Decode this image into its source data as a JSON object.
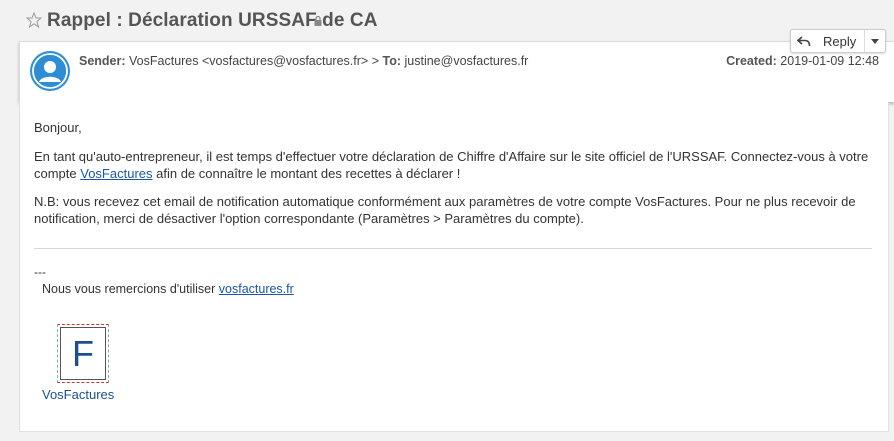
{
  "subject": {
    "title": "Rappel : Déclaration URSSAF de CA",
    "star_icon": "star-outline-icon",
    "lock_icon": "lock-icon"
  },
  "header": {
    "sender_label": "Sender:",
    "sender_value": "VosFactures <vosfactures@vosfactures.fr>",
    "separator": ">",
    "to_label": "To:",
    "to_value": "justine@vosfactures.fr",
    "created_label": "Created:",
    "created_value": "2019-01-09 12:48",
    "avatar_icon": "user-avatar-icon"
  },
  "reply": {
    "label": "Reply",
    "icon": "reply-arrow-icon",
    "caret_icon": "caret-down-icon"
  },
  "body": {
    "greeting": "Bonjour,",
    "para1_before": "En tant qu'auto-entrepreneur, il est temps d'effectuer votre déclaration de Chiffre d'Affaire sur le site officiel de l'URSSAF. Connectez-vous à votre compte ",
    "para1_link": "VosFactures",
    "para1_after": " afin de connaître le montant des recettes à déclarer !",
    "para2": "N.B: vous recevez cet email de notification automatique conformément aux paramètres de votre compte VosFactures. Pour ne plus recevoir de notification, merci de désactiver l'option correspondante (Paramètres > Paramètres du compte).",
    "sig_dashes": "---",
    "sig_thanks_before": "Nous vous remercions d'utiliser ",
    "sig_link": "vosfactures.fr",
    "logo_letter": "F",
    "logo_caption": "VosFactures"
  },
  "colors": {
    "link": "#1a55a6",
    "avatar_bg": "#2d8ed6",
    "logo_blue": "#1b4f8f"
  }
}
